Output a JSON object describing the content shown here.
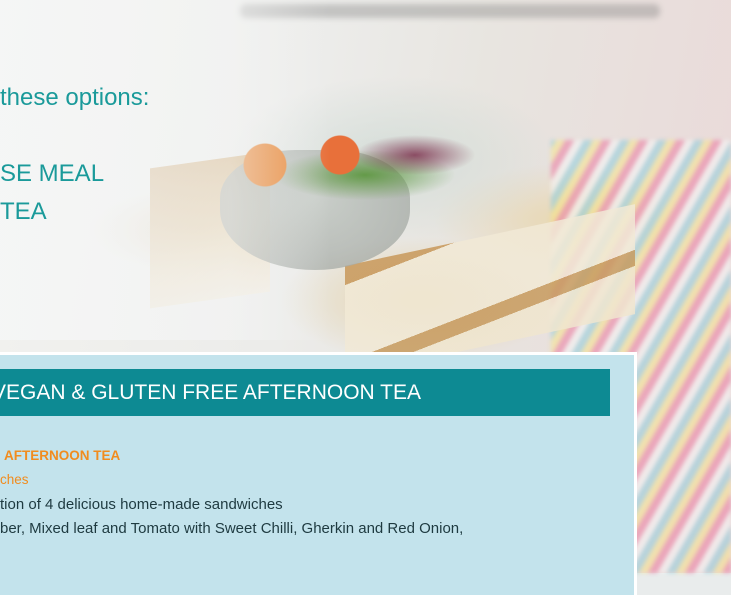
{
  "options": {
    "heading": "these options:",
    "option_1": "SE MEAL",
    "option_2": "TEA"
  },
  "menu_panel": {
    "header": "VEGAN & GLUTEN FREE AFTERNOON TEA",
    "title": "AFTERNOON TEA",
    "subtitle": "ches",
    "line_1": "tion of 4 delicious home-made sandwiches",
    "line_2": "ber, Mixed leaf and Tomato with Sweet Chilli, Gherkin and Red Onion,"
  },
  "colors": {
    "accent_teal": "#0d8a93",
    "text_teal": "#1a9a9a",
    "panel_bg": "#c3e3ec",
    "highlight_orange": "#f18c1e"
  }
}
